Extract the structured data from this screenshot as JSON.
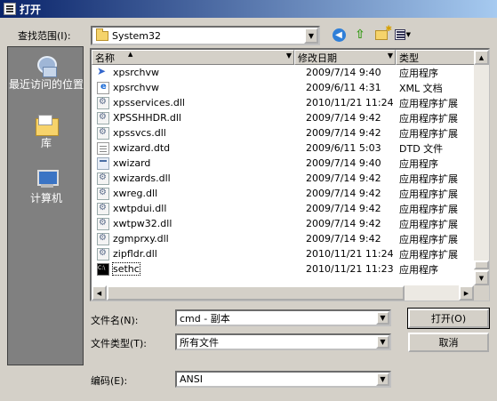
{
  "window": {
    "title": "打开"
  },
  "lookin": {
    "label": "查找范围(I):",
    "value": "System32"
  },
  "places": [
    {
      "label": "最近访问的位置",
      "icon": "recent-places-icon"
    },
    {
      "label": "库",
      "icon": "libraries-icon"
    },
    {
      "label": "计算机",
      "icon": "computer-icon"
    }
  ],
  "columns": {
    "name": "名称",
    "date": "修改日期",
    "type": "类型"
  },
  "files": [
    {
      "name": "xpsrchvw",
      "date": "2009/7/14 9:40",
      "type": "应用程序",
      "icon": "arrow"
    },
    {
      "name": "xpsrchvw",
      "date": "2009/6/11 4:31",
      "type": "XML 文档",
      "icon": "xml"
    },
    {
      "name": "xpsservices.dll",
      "date": "2010/11/21 11:24",
      "type": "应用程序扩展",
      "icon": "dll"
    },
    {
      "name": "XPSSHHDR.dll",
      "date": "2009/7/14 9:42",
      "type": "应用程序扩展",
      "icon": "dll"
    },
    {
      "name": "xpssvcs.dll",
      "date": "2009/7/14 9:42",
      "type": "应用程序扩展",
      "icon": "dll"
    },
    {
      "name": "xwizard.dtd",
      "date": "2009/6/11 5:03",
      "type": "DTD 文件",
      "icon": "txt"
    },
    {
      "name": "xwizard",
      "date": "2009/7/14 9:40",
      "type": "应用程序",
      "icon": "exe"
    },
    {
      "name": "xwizards.dll",
      "date": "2009/7/14 9:42",
      "type": "应用程序扩展",
      "icon": "dll"
    },
    {
      "name": "xwreg.dll",
      "date": "2009/7/14 9:42",
      "type": "应用程序扩展",
      "icon": "dll"
    },
    {
      "name": "xwtpdui.dll",
      "date": "2009/7/14 9:42",
      "type": "应用程序扩展",
      "icon": "dll"
    },
    {
      "name": "xwtpw32.dll",
      "date": "2009/7/14 9:42",
      "type": "应用程序扩展",
      "icon": "dll"
    },
    {
      "name": "zgmprxy.dll",
      "date": "2009/7/14 9:42",
      "type": "应用程序扩展",
      "icon": "dll"
    },
    {
      "name": "zipfldr.dll",
      "date": "2010/11/21 11:24",
      "type": "应用程序扩展",
      "icon": "dll"
    },
    {
      "name": "sethc",
      "date": "2010/11/21 11:23",
      "type": "应用程序",
      "icon": "cmd"
    }
  ],
  "form": {
    "filename_label": "文件名(N):",
    "filename_value": "cmd - 副本",
    "filetype_label": "文件类型(T):",
    "filetype_value": "所有文件",
    "encoding_label": "编码(E):",
    "encoding_value": "ANSI"
  },
  "buttons": {
    "open": "打开(O)",
    "cancel": "取消"
  },
  "colors": {
    "title_start": "#0a246a",
    "title_end": "#a6caf0",
    "places_bg": "#808080"
  }
}
